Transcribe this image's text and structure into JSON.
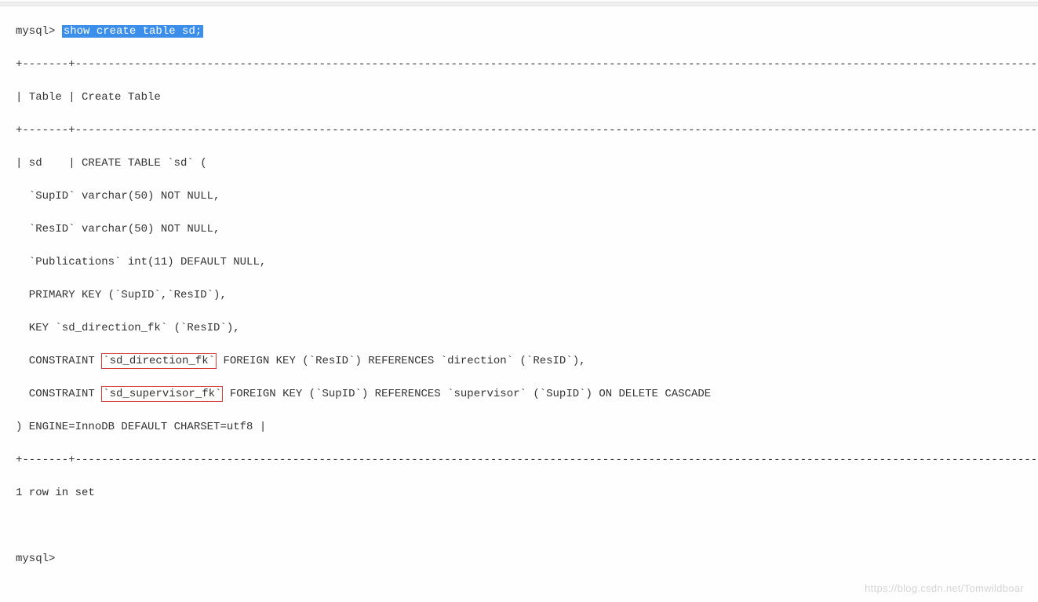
{
  "prompt1_prefix": "mysql> ",
  "prompt1_command": "show create table sd;",
  "sep_line1": "+-------+----------------------------------------------------------------------------------------------------------------------------------------------------------------------------------------------------------------------------------------------------------------------------------------------------------------------------------------------------------------------------------------------------------------------------------------------+",
  "header_line": "| Table | Create Table                                                                                                                                                                                                                                                                                                                                                                                                                                   |",
  "sep_line2": "+-------+----------------------------------------------------------------------------------------------------------------------------------------------------------------------------------------------------------------------------------------------------------------------------------------------------------------------------------------------------------------------------------------------------------------------------------------------------+",
  "body_l1": "| sd    | CREATE TABLE `sd` (",
  "body_l2": "  `SupID` varchar(50) NOT NULL,",
  "body_l3": "  `ResID` varchar(50) NOT NULL,",
  "body_l4": "  `Publications` int(11) DEFAULT NULL,",
  "body_l5": "  PRIMARY KEY (`SupID`,`ResID`),",
  "body_l6": "  KEY `sd_direction_fk` (`ResID`),",
  "body_l7_pre": "  CONSTRAINT ",
  "body_l7_hl": "`sd_direction_fk`",
  "body_l7_post": " FOREIGN KEY (`ResID`) REFERENCES `direction` (`ResID`),",
  "body_l8_pre": "  CONSTRAINT ",
  "body_l8_hl": "`sd_supervisor_fk`",
  "body_l8_post": " FOREIGN KEY (`SupID`) REFERENCES `supervisor` (`SupID`) ON DELETE CASCADE",
  "body_l9": ") ENGINE=InnoDB DEFAULT CHARSET=utf8 |",
  "sep_line3": "+-------+----------------------------------------------------------------------------------------------------------------------------------------------------------------------------------------------------------------------------------------------------------------------------------------------------------------------------------------------------------------------------------------------------------------------------------------------------+",
  "footer_rows": "1 row in set",
  "prompt2": "mysql> ",
  "watermark_text": "https://blog.csdn.net/Tomwildboar"
}
